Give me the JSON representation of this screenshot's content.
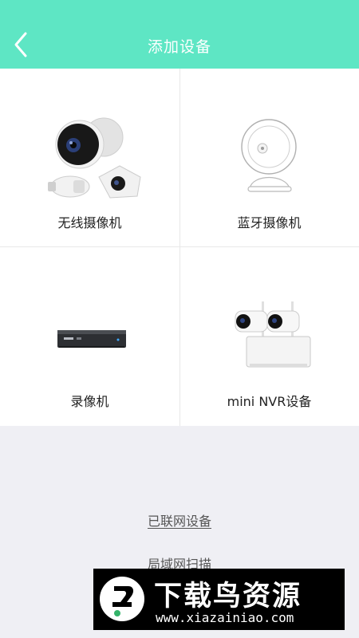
{
  "header": {
    "title": "添加设备",
    "back_icon": "chevron-left-icon",
    "background": "#5ee6c4"
  },
  "devices": [
    {
      "label": "无线摄像机",
      "icon": "wireless-camera-image"
    },
    {
      "label": "蓝牙摄像机",
      "icon": "bluetooth-camera-image"
    },
    {
      "label": "录像机",
      "icon": "recorder-image"
    },
    {
      "label": "mini NVR设备",
      "icon": "mini-nvr-image"
    }
  ],
  "links": {
    "online_devices": "已联网设备",
    "lan_scan": "局域网扫描"
  },
  "watermark": {
    "title": "下载鸟资源",
    "url": "www.xiazainiao.com"
  }
}
